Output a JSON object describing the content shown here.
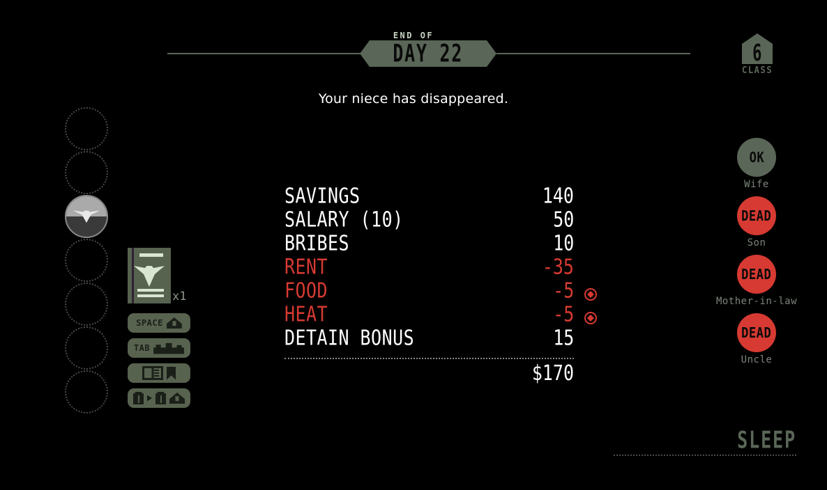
{
  "header": {
    "end_of_label": "END OF",
    "day_label": "DAY 22"
  },
  "class_badge": {
    "number": "6",
    "label": "CLASS"
  },
  "event_message": "Your niece has disappeared.",
  "inventory": {
    "passport_icon": "passport-icon",
    "count_label": "x1"
  },
  "hotkeys": [
    {
      "key_label": "SPACE",
      "icon": "stamp-icon"
    },
    {
      "key_label": "TAB",
      "icon": "desk-icon"
    },
    {
      "key_label": "",
      "icon": "rulebook-icon"
    },
    {
      "key_label": "",
      "icon": "document-transfer-icon"
    }
  ],
  "slots": [
    {
      "state": "empty"
    },
    {
      "state": "empty"
    },
    {
      "state": "filled",
      "icon": "medal-icon"
    },
    {
      "state": "empty"
    },
    {
      "state": "empty"
    },
    {
      "state": "empty"
    },
    {
      "state": "empty"
    }
  ],
  "stats": {
    "rows": [
      {
        "name": "SAVINGS",
        "value": "140",
        "sign": "positive",
        "marker": false
      },
      {
        "name": "SALARY (10)",
        "value": "50",
        "sign": "positive",
        "marker": false
      },
      {
        "name": "BRIBES",
        "value": "10",
        "sign": "positive",
        "marker": false
      },
      {
        "name": "RENT",
        "value": "-35",
        "sign": "negative",
        "marker": false
      },
      {
        "name": "FOOD",
        "value": "-5",
        "sign": "negative",
        "marker": true
      },
      {
        "name": "HEAT",
        "value": "-5",
        "sign": "negative",
        "marker": true
      },
      {
        "name": "DETAIN BONUS",
        "value": "15",
        "sign": "positive",
        "marker": false
      }
    ],
    "total": "$170"
  },
  "family": [
    {
      "status": "OK",
      "name": "Wife",
      "state": "ok"
    },
    {
      "status": "DEAD",
      "name": "Son",
      "state": "dead"
    },
    {
      "status": "DEAD",
      "name": "Mother-in-law",
      "state": "dead"
    },
    {
      "status": "DEAD",
      "name": "Uncle",
      "state": "dead"
    }
  ],
  "sleep_button": {
    "label": "SLEEP"
  },
  "colors": {
    "background": "#000000",
    "accent_green": "#5a6657",
    "danger_red": "#d63a32",
    "text_white": "#ffffff",
    "muted_gray": "#7b857a"
  }
}
